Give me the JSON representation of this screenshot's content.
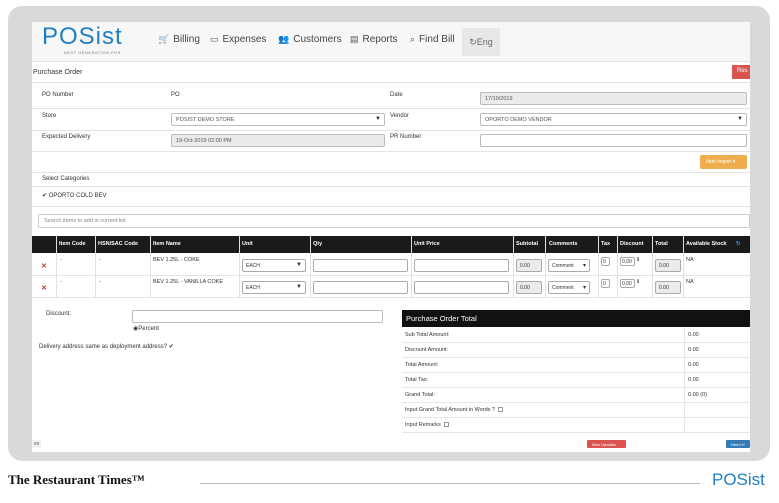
{
  "nav": {
    "logo": "POSist",
    "logo_tagline": "NEXT GENERATION POS",
    "items": [
      {
        "label": "Billing",
        "icon": "cart-icon"
      },
      {
        "label": "Expenses",
        "icon": "money-icon"
      },
      {
        "label": "Customers",
        "icon": "users-icon"
      },
      {
        "label": "Reports",
        "icon": "chart-icon"
      },
      {
        "label": "Find Bill",
        "icon": "search-icon"
      }
    ],
    "lang": "Eng"
  },
  "header": {
    "title": "Purchase Order",
    "reset_label": "Res"
  },
  "form": {
    "po_number_label": "PO Number",
    "po_number_value": "PO",
    "date_label": "Date",
    "date_value": "17/10/2019",
    "store_label": "Store",
    "store_value": "POSIST DEMO STORE",
    "vendor_label": "Vendor",
    "vendor_value": "OPORTO DEMO VENDOR",
    "expected_delivery_label": "Expected Delivery",
    "expected_delivery_value": "19-Oct-2019 02:00 PM",
    "pr_number_label": "PR Number",
    "pr_number_value": "",
    "item_import_label": "Item Import",
    "select_categories_label": "Select Categories",
    "category_checked": "✔ OPORTO COLD BEV",
    "search_placeholder": "Search items to add in current list"
  },
  "table": {
    "headers": [
      "Item Code",
      "HSN/SAC Code",
      "Item Name",
      "Unit",
      "Qty",
      "Unit Price",
      "Subtotal",
      "Comments",
      "Tax",
      "Discount",
      "Total",
      "Available Stock"
    ],
    "rows": [
      {
        "item_code": "-",
        "hsn": "-",
        "name": "BEV 1.25L - COKE",
        "unit": "EACH",
        "subtotal": "0.00",
        "comment": "Comment",
        "tax": "0",
        "discount": "0.00",
        "total": "0.00",
        "stock": "NA"
      },
      {
        "item_code": "-",
        "hsn": "-",
        "name": "BEV 1.25L - VANILLA COKE",
        "unit": "EACH",
        "subtotal": "0.00",
        "comment": "Comment",
        "tax": "0",
        "discount": "0.00",
        "total": "0.00",
        "stock": "NA"
      }
    ]
  },
  "bottom": {
    "discount_label": "Discount:",
    "percent_label": "Percent",
    "delivery_label": "Delivery address same as deployment address?",
    "summary_title": "Purchase Order Total",
    "summary": [
      {
        "k": "Sub Total Amount:",
        "v": "0.00"
      },
      {
        "k": "Discount Amount:",
        "v": "0.00"
      },
      {
        "k": "Total Amount:",
        "v": "0.00"
      },
      {
        "k": "Total Tax:",
        "v": "0.00"
      },
      {
        "k": "Grand Total:",
        "v": "0.00 (0)"
      },
      {
        "k": "Input Grand Total Amount in Words ?",
        "v": ""
      },
      {
        "k": "Input Remarks",
        "v": ""
      }
    ],
    "new_updates_label": "New Updates",
    "need_help_label": "Need H",
    "corner_text": "es"
  },
  "footer": {
    "title": "The Restaurant Times™",
    "logo": "POSist"
  }
}
